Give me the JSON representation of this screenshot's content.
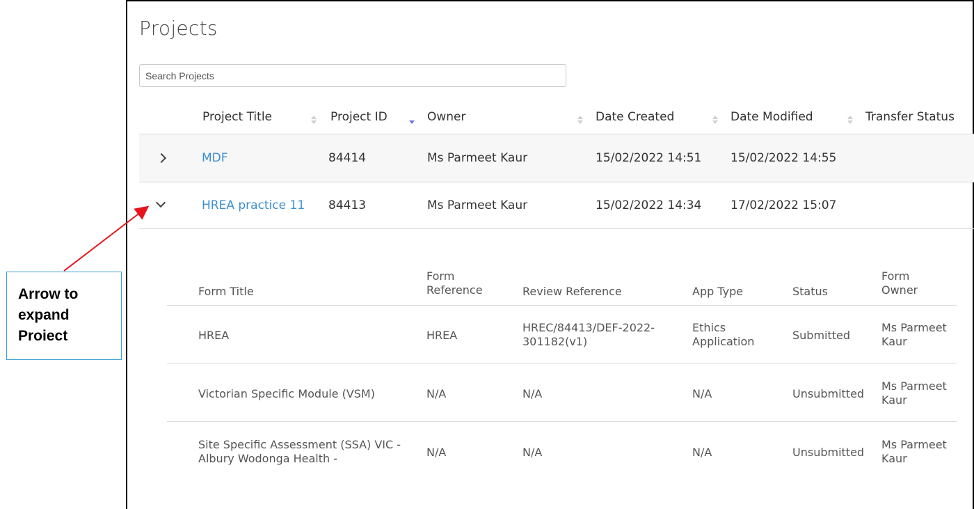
{
  "page": {
    "title": "Projects"
  },
  "search": {
    "placeholder": "Search Projects"
  },
  "table": {
    "columns": [
      "Project Title",
      "Project ID",
      "Owner",
      "Date Created",
      "Date Modified",
      "Transfer Status"
    ],
    "sorted_column": "Project ID",
    "rows": [
      {
        "title": "MDF",
        "id": "84414",
        "owner": "Ms Parmeet Kaur",
        "created": "15/02/2022 14:51",
        "modified": "15/02/2022 14:55",
        "expanded": false
      },
      {
        "title": "HREA practice 11",
        "id": "84413",
        "owner": "Ms Parmeet Kaur",
        "created": "15/02/2022 14:34",
        "modified": "17/02/2022 15:07",
        "expanded": true
      }
    ]
  },
  "forms": {
    "columns": {
      "title": "Form Title",
      "reference_line1": "Form",
      "reference_line2": "Reference",
      "review": "Review Reference",
      "app_type": "App Type",
      "status": "Status",
      "owner_line1": "Form",
      "owner_line2": "Owner"
    },
    "rows": [
      {
        "title": "HREA",
        "reference": "HREA",
        "review_line1": "HREC/84413/DEF-2022-",
        "review_line2": "301182(v1)",
        "app_type_line1": "Ethics",
        "app_type_line2": "Application",
        "status": "Submitted",
        "owner_line1": "Ms Parmeet",
        "owner_line2": "Kaur"
      },
      {
        "title": "Victorian Specific Module (VSM)",
        "reference": "N/A",
        "review": "N/A",
        "app_type": "N/A",
        "status": "Unsubmitted",
        "owner_line1": "Ms Parmeet",
        "owner_line2": "Kaur"
      },
      {
        "title_line1": "Site Specific Assessment (SSA) VIC -",
        "title_line2": "Albury Wodonga Health -",
        "reference": "N/A",
        "review": "N/A",
        "app_type": "N/A",
        "status": "Unsubmitted",
        "owner_line1": "Ms Parmeet",
        "owner_line2": "Kaur"
      }
    ]
  },
  "annotation": {
    "line1": "Arrow to",
    "line2": "expand",
    "line3": "Proiect",
    "arrow_color": "#e8141c",
    "box_border_color": "#3aa0d8"
  },
  "colors": {
    "link": "#3b8fd1",
    "sort_active": "#6e74d4",
    "row_highlight": "#f7f7f7"
  }
}
